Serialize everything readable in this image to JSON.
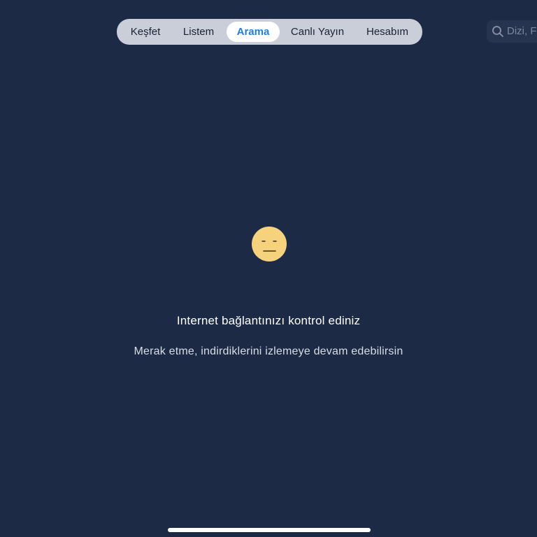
{
  "tabs": [
    {
      "label": "Keşfet",
      "active": false
    },
    {
      "label": "Listem",
      "active": false
    },
    {
      "label": "Arama",
      "active": true
    },
    {
      "label": "Canlı Yayın",
      "active": false
    },
    {
      "label": "Hesabım",
      "active": false
    }
  ],
  "search": {
    "text": "Dizi, F",
    "icon": "search-icon"
  },
  "empty_state": {
    "icon": "neutral-face-icon",
    "title": "Internet bağlantınızı kontrol ediniz",
    "subtitle": "Merak etme, indirdiklerini izlemeye devam edebilirsin"
  },
  "colors": {
    "background": "#1c2a45",
    "tab_bar": "#c9ced8",
    "active_tab_text": "#1f7fe0",
    "emoji_face": "#f6d27c"
  }
}
